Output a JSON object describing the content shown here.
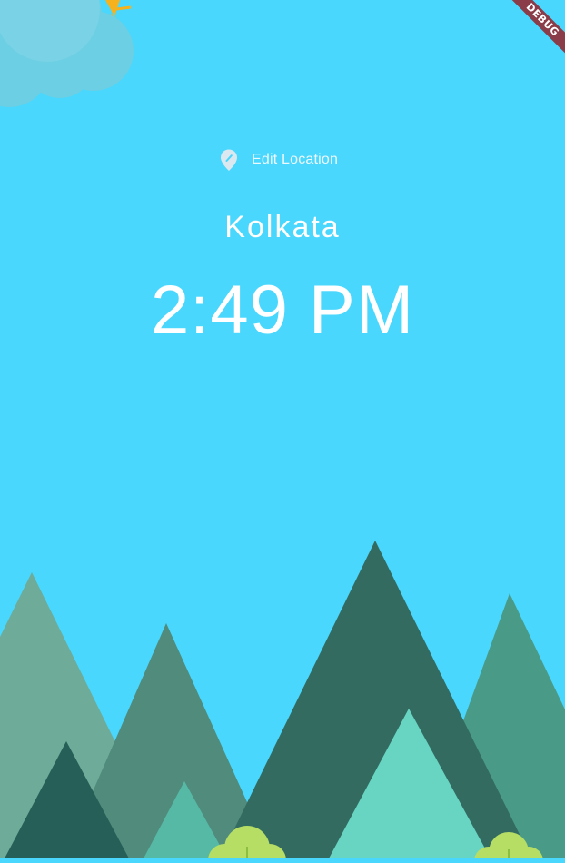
{
  "app": {
    "debug_banner": "DEBUG"
  },
  "location": {
    "edit_label": "Edit Location",
    "icon": "location-pin-icon",
    "city": "Kolkata"
  },
  "clock": {
    "time": "2:49 PM"
  },
  "colors": {
    "sky": "#49d7fd",
    "cloud": "#6ccfe3",
    "sun": "#f6b21d",
    "mountain_light": "#6eab98",
    "mountain_mid": "#508b7c",
    "mountain_dark": "#336b61",
    "mountain_teal": "#4a9a88",
    "mountain_front_dark": "#265f57",
    "mountain_front_mint": "#68d5c2",
    "bush": "#b6dd64"
  }
}
